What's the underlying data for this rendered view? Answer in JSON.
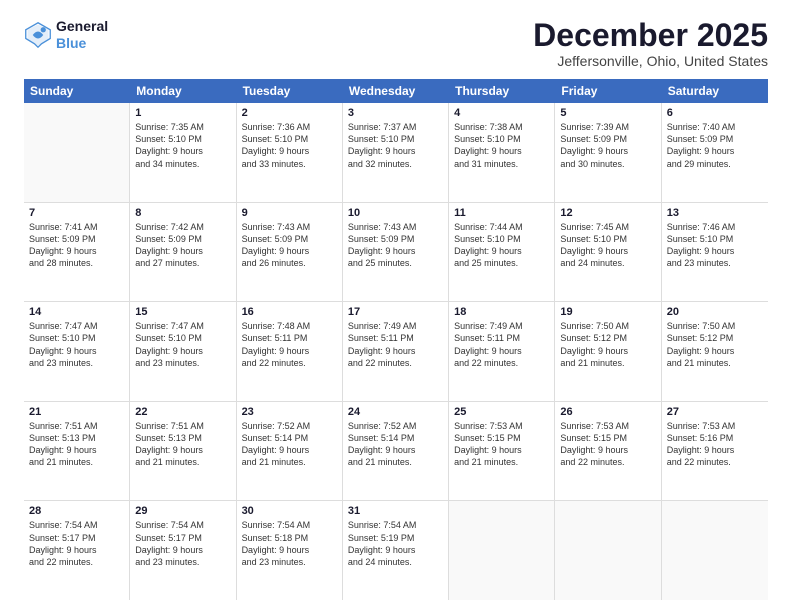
{
  "logo": {
    "line1": "General",
    "line2": "Blue"
  },
  "title": "December 2025",
  "subtitle": "Jeffersonville, Ohio, United States",
  "days_of_week": [
    "Sunday",
    "Monday",
    "Tuesday",
    "Wednesday",
    "Thursday",
    "Friday",
    "Saturday"
  ],
  "weeks": [
    [
      {
        "day": "",
        "sunrise": "",
        "sunset": "",
        "daylight": "",
        "empty": true
      },
      {
        "day": "1",
        "sunrise": "Sunrise: 7:35 AM",
        "sunset": "Sunset: 5:10 PM",
        "daylight": "Daylight: 9 hours",
        "daylight2": "and 34 minutes."
      },
      {
        "day": "2",
        "sunrise": "Sunrise: 7:36 AM",
        "sunset": "Sunset: 5:10 PM",
        "daylight": "Daylight: 9 hours",
        "daylight2": "and 33 minutes."
      },
      {
        "day": "3",
        "sunrise": "Sunrise: 7:37 AM",
        "sunset": "Sunset: 5:10 PM",
        "daylight": "Daylight: 9 hours",
        "daylight2": "and 32 minutes."
      },
      {
        "day": "4",
        "sunrise": "Sunrise: 7:38 AM",
        "sunset": "Sunset: 5:10 PM",
        "daylight": "Daylight: 9 hours",
        "daylight2": "and 31 minutes."
      },
      {
        "day": "5",
        "sunrise": "Sunrise: 7:39 AM",
        "sunset": "Sunset: 5:09 PM",
        "daylight": "Daylight: 9 hours",
        "daylight2": "and 30 minutes."
      },
      {
        "day": "6",
        "sunrise": "Sunrise: 7:40 AM",
        "sunset": "Sunset: 5:09 PM",
        "daylight": "Daylight: 9 hours",
        "daylight2": "and 29 minutes."
      }
    ],
    [
      {
        "day": "7",
        "sunrise": "Sunrise: 7:41 AM",
        "sunset": "Sunset: 5:09 PM",
        "daylight": "Daylight: 9 hours",
        "daylight2": "and 28 minutes."
      },
      {
        "day": "8",
        "sunrise": "Sunrise: 7:42 AM",
        "sunset": "Sunset: 5:09 PM",
        "daylight": "Daylight: 9 hours",
        "daylight2": "and 27 minutes."
      },
      {
        "day": "9",
        "sunrise": "Sunrise: 7:43 AM",
        "sunset": "Sunset: 5:09 PM",
        "daylight": "Daylight: 9 hours",
        "daylight2": "and 26 minutes."
      },
      {
        "day": "10",
        "sunrise": "Sunrise: 7:43 AM",
        "sunset": "Sunset: 5:09 PM",
        "daylight": "Daylight: 9 hours",
        "daylight2": "and 25 minutes."
      },
      {
        "day": "11",
        "sunrise": "Sunrise: 7:44 AM",
        "sunset": "Sunset: 5:10 PM",
        "daylight": "Daylight: 9 hours",
        "daylight2": "and 25 minutes."
      },
      {
        "day": "12",
        "sunrise": "Sunrise: 7:45 AM",
        "sunset": "Sunset: 5:10 PM",
        "daylight": "Daylight: 9 hours",
        "daylight2": "and 24 minutes."
      },
      {
        "day": "13",
        "sunrise": "Sunrise: 7:46 AM",
        "sunset": "Sunset: 5:10 PM",
        "daylight": "Daylight: 9 hours",
        "daylight2": "and 23 minutes."
      }
    ],
    [
      {
        "day": "14",
        "sunrise": "Sunrise: 7:47 AM",
        "sunset": "Sunset: 5:10 PM",
        "daylight": "Daylight: 9 hours",
        "daylight2": "and 23 minutes."
      },
      {
        "day": "15",
        "sunrise": "Sunrise: 7:47 AM",
        "sunset": "Sunset: 5:10 PM",
        "daylight": "Daylight: 9 hours",
        "daylight2": "and 23 minutes."
      },
      {
        "day": "16",
        "sunrise": "Sunrise: 7:48 AM",
        "sunset": "Sunset: 5:11 PM",
        "daylight": "Daylight: 9 hours",
        "daylight2": "and 22 minutes."
      },
      {
        "day": "17",
        "sunrise": "Sunrise: 7:49 AM",
        "sunset": "Sunset: 5:11 PM",
        "daylight": "Daylight: 9 hours",
        "daylight2": "and 22 minutes."
      },
      {
        "day": "18",
        "sunrise": "Sunrise: 7:49 AM",
        "sunset": "Sunset: 5:11 PM",
        "daylight": "Daylight: 9 hours",
        "daylight2": "and 22 minutes."
      },
      {
        "day": "19",
        "sunrise": "Sunrise: 7:50 AM",
        "sunset": "Sunset: 5:12 PM",
        "daylight": "Daylight: 9 hours",
        "daylight2": "and 21 minutes."
      },
      {
        "day": "20",
        "sunrise": "Sunrise: 7:50 AM",
        "sunset": "Sunset: 5:12 PM",
        "daylight": "Daylight: 9 hours",
        "daylight2": "and 21 minutes."
      }
    ],
    [
      {
        "day": "21",
        "sunrise": "Sunrise: 7:51 AM",
        "sunset": "Sunset: 5:13 PM",
        "daylight": "Daylight: 9 hours",
        "daylight2": "and 21 minutes."
      },
      {
        "day": "22",
        "sunrise": "Sunrise: 7:51 AM",
        "sunset": "Sunset: 5:13 PM",
        "daylight": "Daylight: 9 hours",
        "daylight2": "and 21 minutes."
      },
      {
        "day": "23",
        "sunrise": "Sunrise: 7:52 AM",
        "sunset": "Sunset: 5:14 PM",
        "daylight": "Daylight: 9 hours",
        "daylight2": "and 21 minutes."
      },
      {
        "day": "24",
        "sunrise": "Sunrise: 7:52 AM",
        "sunset": "Sunset: 5:14 PM",
        "daylight": "Daylight: 9 hours",
        "daylight2": "and 21 minutes."
      },
      {
        "day": "25",
        "sunrise": "Sunrise: 7:53 AM",
        "sunset": "Sunset: 5:15 PM",
        "daylight": "Daylight: 9 hours",
        "daylight2": "and 21 minutes."
      },
      {
        "day": "26",
        "sunrise": "Sunrise: 7:53 AM",
        "sunset": "Sunset: 5:15 PM",
        "daylight": "Daylight: 9 hours",
        "daylight2": "and 22 minutes."
      },
      {
        "day": "27",
        "sunrise": "Sunrise: 7:53 AM",
        "sunset": "Sunset: 5:16 PM",
        "daylight": "Daylight: 9 hours",
        "daylight2": "and 22 minutes."
      }
    ],
    [
      {
        "day": "28",
        "sunrise": "Sunrise: 7:54 AM",
        "sunset": "Sunset: 5:17 PM",
        "daylight": "Daylight: 9 hours",
        "daylight2": "and 22 minutes."
      },
      {
        "day": "29",
        "sunrise": "Sunrise: 7:54 AM",
        "sunset": "Sunset: 5:17 PM",
        "daylight": "Daylight: 9 hours",
        "daylight2": "and 23 minutes."
      },
      {
        "day": "30",
        "sunrise": "Sunrise: 7:54 AM",
        "sunset": "Sunset: 5:18 PM",
        "daylight": "Daylight: 9 hours",
        "daylight2": "and 23 minutes."
      },
      {
        "day": "31",
        "sunrise": "Sunrise: 7:54 AM",
        "sunset": "Sunset: 5:19 PM",
        "daylight": "Daylight: 9 hours",
        "daylight2": "and 24 minutes."
      },
      {
        "day": "",
        "sunrise": "",
        "sunset": "",
        "daylight": "",
        "daylight2": "",
        "empty": true
      },
      {
        "day": "",
        "sunrise": "",
        "sunset": "",
        "daylight": "",
        "daylight2": "",
        "empty": true
      },
      {
        "day": "",
        "sunrise": "",
        "sunset": "",
        "daylight": "",
        "daylight2": "",
        "empty": true
      }
    ]
  ]
}
